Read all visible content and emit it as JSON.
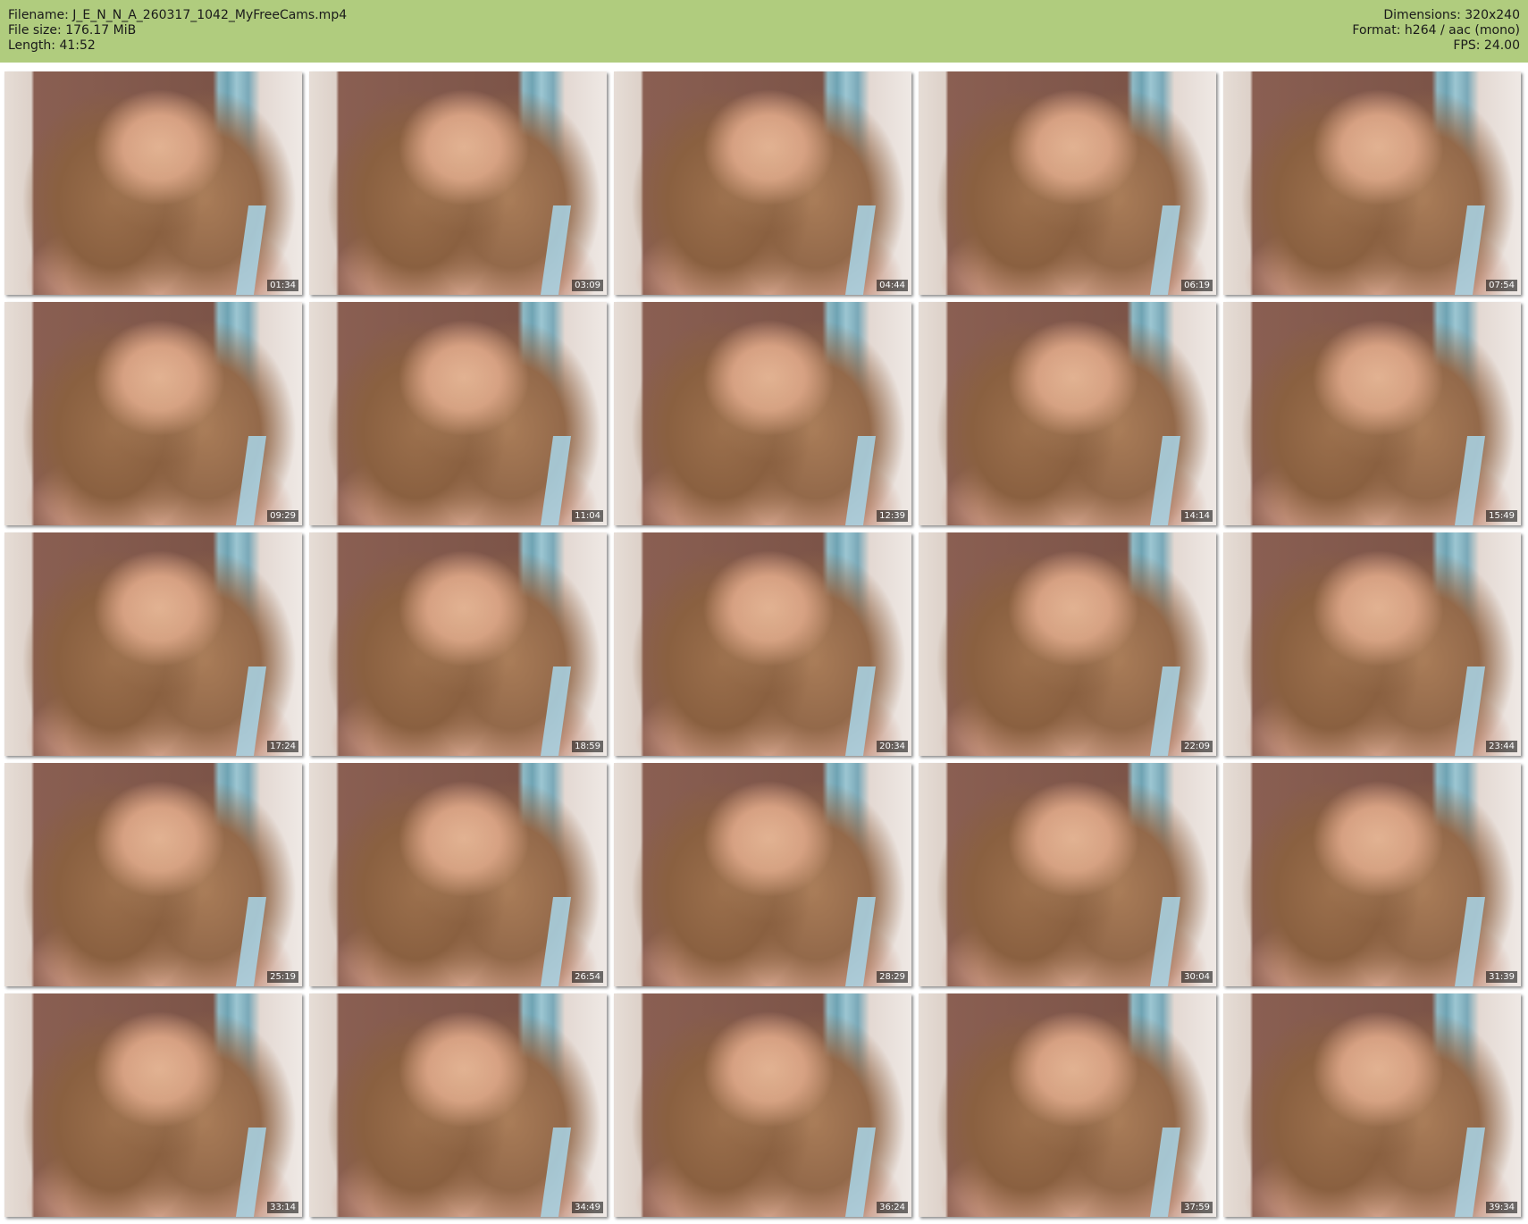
{
  "header": {
    "filename": "Filename: J_E_N_N_A_260317_1042_MyFreeCams.mp4",
    "filesize": "File size: 176.17 MiB",
    "length": "Length: 41:52",
    "dimensions": "Dimensions: 320x240",
    "format": "Format: h264 / aac (mono)",
    "fps": "FPS: 24.00"
  },
  "colors": {
    "header_background": "#b0cc7e",
    "page_background": "#ffffff"
  },
  "thumbnails": [
    {
      "timestamp": "01:34"
    },
    {
      "timestamp": "03:09"
    },
    {
      "timestamp": "04:44"
    },
    {
      "timestamp": "06:19"
    },
    {
      "timestamp": "07:54"
    },
    {
      "timestamp": "09:29"
    },
    {
      "timestamp": "11:04"
    },
    {
      "timestamp": "12:39"
    },
    {
      "timestamp": "14:14"
    },
    {
      "timestamp": "15:49"
    },
    {
      "timestamp": "17:24"
    },
    {
      "timestamp": "18:59"
    },
    {
      "timestamp": "20:34"
    },
    {
      "timestamp": "22:09"
    },
    {
      "timestamp": "23:44"
    },
    {
      "timestamp": "25:19"
    },
    {
      "timestamp": "26:54"
    },
    {
      "timestamp": "28:29"
    },
    {
      "timestamp": "30:04"
    },
    {
      "timestamp": "31:39"
    },
    {
      "timestamp": "33:14"
    },
    {
      "timestamp": "34:49"
    },
    {
      "timestamp": "36:24"
    },
    {
      "timestamp": "37:59"
    },
    {
      "timestamp": "39:34"
    }
  ]
}
